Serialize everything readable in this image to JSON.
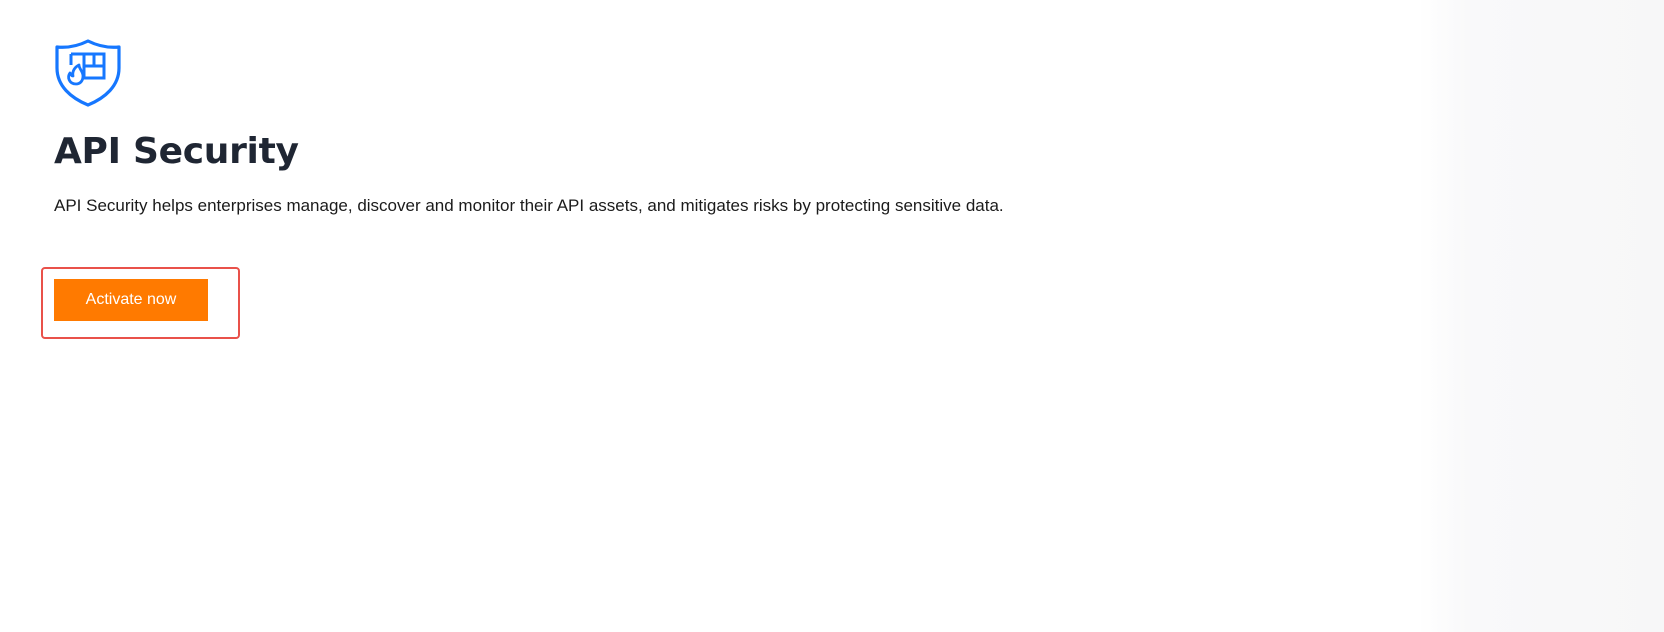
{
  "product": {
    "icon": "shield-firewall-icon",
    "title": "API Security",
    "description": "API Security helps enterprises manage, discover and monitor their API assets, and mitigates risks by protecting sensitive data."
  },
  "actions": {
    "activate_label": "Activate now"
  },
  "colors": {
    "accent_blue": "#1677ff",
    "cta_orange": "#ff7a00",
    "highlight_red": "#e9514a",
    "title_text": "#1f2633"
  }
}
